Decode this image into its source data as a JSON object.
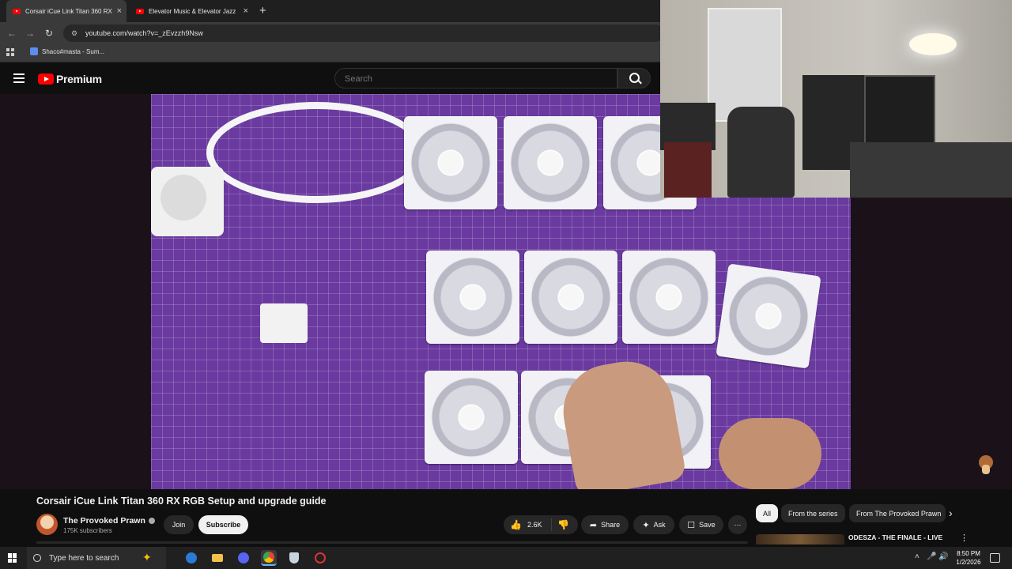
{
  "browser": {
    "tabs": [
      {
        "title": "Corsair iCue Link Titan 360 RX"
      },
      {
        "title": "Elevator Music & Elevator Jazz"
      }
    ],
    "url": "youtube.com/watch?v=_zEvzzh9Nsw",
    "bookmarks": [
      {
        "label": "Shaco#masta - Sum..."
      }
    ]
  },
  "youtube": {
    "logo_text": "Premium",
    "search_placeholder": "Search",
    "video": {
      "title": "Corsair iCue Link Titan 360 RX RGB Setup and upgrade guide",
      "channel": "The Provoked Prawn",
      "subscribers": "175K subscribers",
      "join_label": "Join",
      "subscribe_label": "Subscribe",
      "likes": "2.6K",
      "share_label": "Share",
      "ask_label": "Ask",
      "save_label": "Save"
    },
    "chips": [
      "All",
      "From the series",
      "From The Provoked Prawn"
    ],
    "recommendation": {
      "title": "ODESZA - THE FINALE - LIVE FROM THE GORGE"
    }
  },
  "taskbar": {
    "search_placeholder": "Type here to search",
    "time": "8:50 PM",
    "date": "1/2/2026"
  },
  "colors": {
    "accent_red": "#ff0000",
    "mat_purple": "#6a3aa0",
    "background": "#0f0f0f"
  }
}
